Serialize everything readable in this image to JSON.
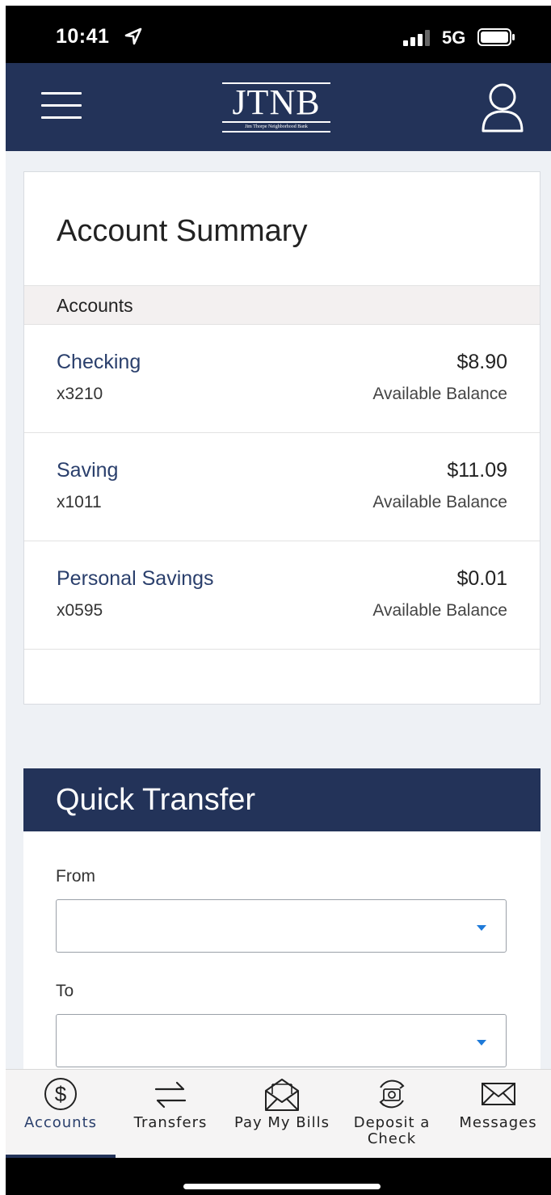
{
  "status_bar": {
    "time": "10:41",
    "network": "5G",
    "icons": [
      "location-arrow-icon",
      "signal-icon",
      "battery-icon"
    ]
  },
  "header": {
    "logo_text": "JTNB",
    "logo_subtitle": "Jim Thorpe Neighborhood Bank",
    "icons": [
      "hamburger-menu-icon",
      "user-profile-icon"
    ],
    "color": "#233359"
  },
  "summary": {
    "title": "Account Summary",
    "section_label": "Accounts",
    "accounts": [
      {
        "name": "Checking",
        "number": "x3210",
        "balance": "$8.90",
        "balance_label": "Available Balance"
      },
      {
        "name": "Saving",
        "number": "x1011",
        "balance": "$11.09",
        "balance_label": "Available Balance"
      },
      {
        "name": "Personal Savings",
        "number": "x0595",
        "balance": "$0.01",
        "balance_label": "Available Balance"
      }
    ]
  },
  "quick_transfer": {
    "title": "Quick Transfer",
    "from_label": "From",
    "from_value": "",
    "to_label": "To",
    "to_value": ""
  },
  "tabs": [
    {
      "label": "Accounts",
      "icon": "dollar-circle-icon",
      "active": true
    },
    {
      "label": "Transfers",
      "icon": "transfer-arrows-icon",
      "active": false
    },
    {
      "label": "Pay My Bills",
      "icon": "envelope-open-icon",
      "active": false
    },
    {
      "label": "Deposit a Check",
      "icon": "camera-deposit-icon",
      "active": false
    },
    {
      "label": "Messages",
      "icon": "envelope-icon",
      "active": false
    }
  ],
  "colors": {
    "brand_navy": "#233359",
    "link_blue": "#2a3f6c",
    "caret_blue": "#1e7ad9",
    "page_bg": "#eef1f5"
  }
}
